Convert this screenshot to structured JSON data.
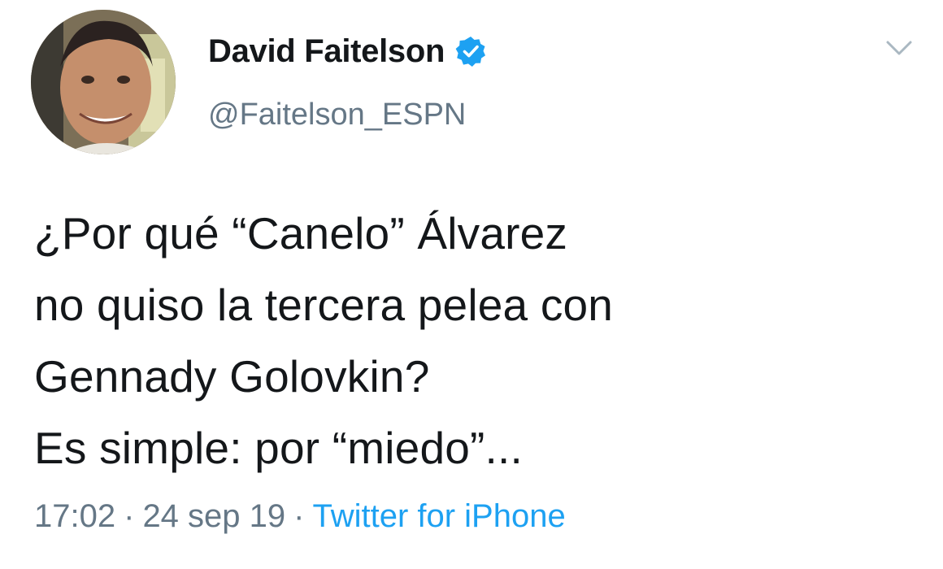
{
  "user": {
    "display_name": "David Faitelson",
    "handle": "@Faitelson_ESPN",
    "verified_icon": "verified-badge-icon"
  },
  "tweet": {
    "lines": [
      "¿Por qué “Canelo” Álvarez",
      "no quiso la tercera pelea con",
      "Gennady Golovkin?",
      "Es simple: por “miedo”..."
    ]
  },
  "meta": {
    "time": "17:02",
    "separator": "·",
    "date": "24 sep 19",
    "source": "Twitter for iPhone"
  },
  "icons": {
    "menu": "chevron-down-icon",
    "avatar": "profile-photo"
  },
  "colors": {
    "text": "#14171a",
    "secondary": "#657786",
    "link": "#1da1f2",
    "verified": "#1da1f2"
  }
}
